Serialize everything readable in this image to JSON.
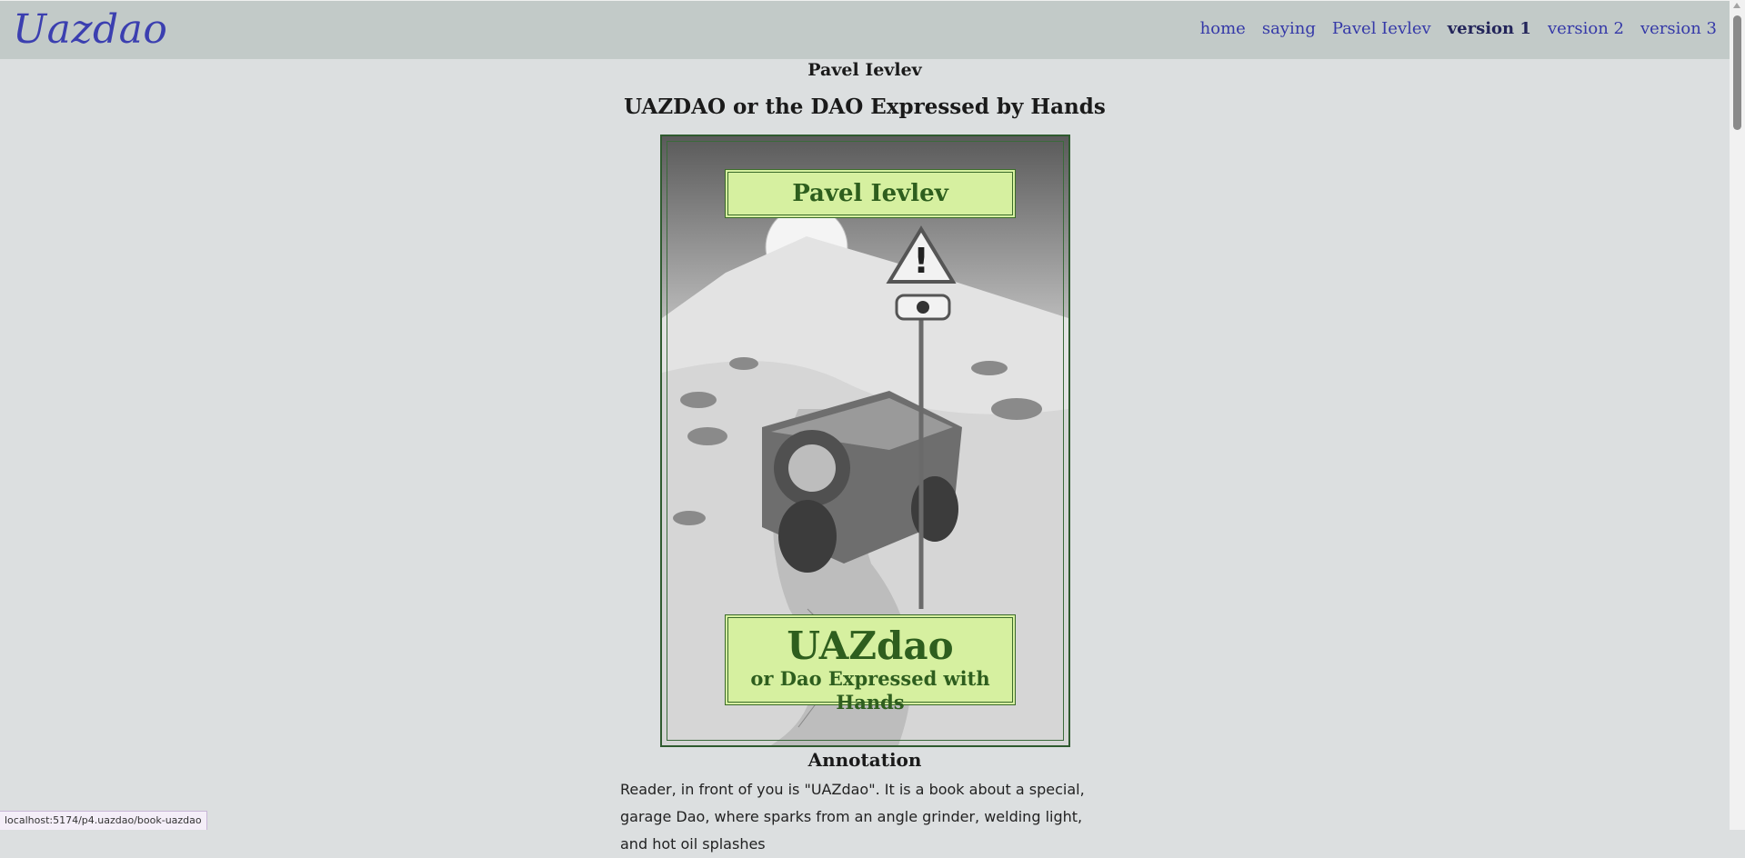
{
  "header": {
    "logo": "Uazdao",
    "nav": [
      "home",
      "saying",
      "Pavel Ievlev",
      "version 1",
      "version 2",
      "version 3"
    ]
  },
  "page": {
    "author": "Pavel Ievlev",
    "title": "UAZDAO or the DAO Expressed by Hands"
  },
  "cover": {
    "author": "Pavel Ievlev",
    "title": "UAZdao",
    "subtitle": "or Dao Expressed with Hands"
  },
  "annotation": {
    "heading": "Annotation",
    "text": "Reader, in front of you is \"UAZdao\". It is a book about a special, garage Dao, where sparks from an angle grinder, welding light, and hot oil splashes"
  },
  "status_bar": {
    "url": "localhost:5174/p4.uazdao/book-uazdao"
  },
  "colors": {
    "nav_bg": "#c2cac8",
    "page_bg": "#dcdfe0",
    "link": "#3539a8",
    "plate_bg": "#d6f0a0",
    "plate_text": "#2e5e1e"
  }
}
